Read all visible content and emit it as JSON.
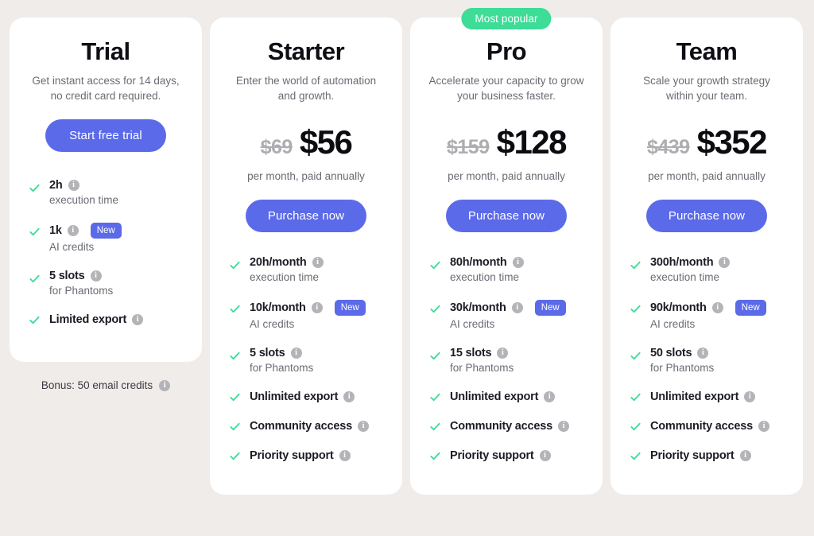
{
  "theme": {
    "page_background": "#f0ece9",
    "card_background": "#ffffff",
    "accent_blue": "#5b6ae8",
    "accent_green": "#3ddc97",
    "check_green": "#3ddc97",
    "info_icon_gray": "#b4b4b8"
  },
  "icons": {
    "check": "check-icon",
    "info": "info-icon"
  },
  "plans": [
    {
      "id": "trial",
      "name": "Trial",
      "description": "Get instant access for 14 days, no credit card required.",
      "badge": null,
      "price_old": null,
      "price_new": null,
      "price_note": null,
      "cta_label": "Start free trial",
      "features": [
        {
          "title": "2h",
          "sub": "execution time",
          "info": true,
          "new_badge": false
        },
        {
          "title": "1k",
          "sub": "AI credits",
          "info": true,
          "new_badge": true,
          "new_label": "New"
        },
        {
          "title": "5 slots",
          "sub": "for Phantoms",
          "info": true,
          "new_badge": false
        },
        {
          "title": "Limited export",
          "sub": null,
          "info": true,
          "new_badge": false
        }
      ],
      "bonus": "Bonus: 50 email credits"
    },
    {
      "id": "starter",
      "name": "Starter",
      "description": "Enter the world of automation and growth.",
      "badge": null,
      "price_old": "$69",
      "price_new": "$56",
      "price_note": "per month, paid annually",
      "cta_label": "Purchase now",
      "features": [
        {
          "title": "20h/month",
          "sub": "execution time",
          "info": true,
          "new_badge": false
        },
        {
          "title": "10k/month",
          "sub": "AI credits",
          "info": true,
          "new_badge": true,
          "new_label": "New"
        },
        {
          "title": "5 slots",
          "sub": "for Phantoms",
          "info": true,
          "new_badge": false
        },
        {
          "title": "Unlimited export",
          "sub": null,
          "info": true,
          "new_badge": false
        },
        {
          "title": "Community access",
          "sub": null,
          "info": true,
          "new_badge": false
        },
        {
          "title": "Priority support",
          "sub": null,
          "info": true,
          "new_badge": false
        }
      ],
      "bonus": null
    },
    {
      "id": "pro",
      "name": "Pro",
      "description": "Accelerate your capacity to grow your business faster.",
      "badge": "Most popular",
      "price_old": "$159",
      "price_new": "$128",
      "price_note": "per month, paid annually",
      "cta_label": "Purchase now",
      "features": [
        {
          "title": "80h/month",
          "sub": "execution time",
          "info": true,
          "new_badge": false
        },
        {
          "title": "30k/month",
          "sub": "AI credits",
          "info": true,
          "new_badge": true,
          "new_label": "New"
        },
        {
          "title": "15 slots",
          "sub": "for Phantoms",
          "info": true,
          "new_badge": false
        },
        {
          "title": "Unlimited export",
          "sub": null,
          "info": true,
          "new_badge": false
        },
        {
          "title": "Community access",
          "sub": null,
          "info": true,
          "new_badge": false
        },
        {
          "title": "Priority support",
          "sub": null,
          "info": true,
          "new_badge": false
        }
      ],
      "bonus": null
    },
    {
      "id": "team",
      "name": "Team",
      "description": "Scale your growth strategy within your team.",
      "badge": null,
      "price_old": "$439",
      "price_new": "$352",
      "price_note": "per month, paid annually",
      "cta_label": "Purchase now",
      "features": [
        {
          "title": "300h/month",
          "sub": "execution time",
          "info": true,
          "new_badge": false
        },
        {
          "title": "90k/month",
          "sub": "AI credits",
          "info": true,
          "new_badge": true,
          "new_label": "New"
        },
        {
          "title": "50 slots",
          "sub": "for Phantoms",
          "info": true,
          "new_badge": false
        },
        {
          "title": "Unlimited export",
          "sub": null,
          "info": true,
          "new_badge": false
        },
        {
          "title": "Community access",
          "sub": null,
          "info": true,
          "new_badge": false
        },
        {
          "title": "Priority support",
          "sub": null,
          "info": true,
          "new_badge": false
        }
      ],
      "bonus": null
    }
  ]
}
